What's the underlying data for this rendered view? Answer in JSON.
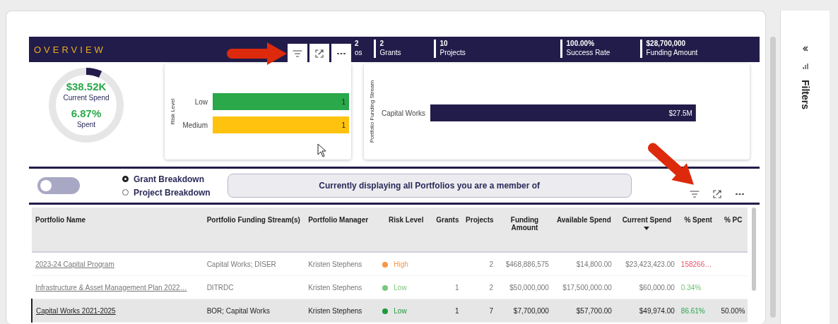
{
  "header": {
    "title": "OVERVIEW",
    "kpis": [
      {
        "value": "2",
        "label": "os"
      },
      {
        "value": "2",
        "label": "Grants"
      },
      {
        "value": "10",
        "label": "Projects"
      },
      {
        "value": "100.00%",
        "label": "Success Rate"
      },
      {
        "value": "$28,700,000",
        "label": "Funding Amount"
      }
    ]
  },
  "gauge": {
    "level": 0.0687,
    "amount": "$38.52K",
    "amount_label": "Current Spend",
    "percent": "6.87%",
    "percent_label": "Spent"
  },
  "risk_chart": {
    "chart_data": {
      "type": "bar",
      "orientation": "horizontal",
      "ylabel": "Risk Level",
      "categories": [
        "Low",
        "Medium"
      ],
      "values": [
        1,
        1
      ],
      "colors": [
        "#2aa84a",
        "#ffc20e"
      ],
      "data_labels": true
    }
  },
  "funding_chart": {
    "chart_data": {
      "type": "bar",
      "orientation": "horizontal",
      "ylabel": "Portfolio Funding Stream",
      "categories": [
        "Capital Works"
      ],
      "values": [
        27.5
      ],
      "colors": [
        "#221c4a"
      ],
      "value_labels": [
        "$27.5M"
      ]
    }
  },
  "toggle": {
    "on": false
  },
  "breakdown": [
    {
      "label": "Grant Breakdown",
      "selected": true
    },
    {
      "label": "Project Breakdown",
      "selected": false
    }
  ],
  "banner": "Currently displaying all Portfolios you are a member of",
  "table": {
    "columns": [
      {
        "label": "Portfolio Name",
        "sorted": false
      },
      {
        "label": "Portfolio Funding Stream(s)",
        "sorted": false
      },
      {
        "label": "Portfolio Manager",
        "sorted": false
      },
      {
        "label": "Risk Level",
        "sorted": false
      },
      {
        "label": "Grants",
        "sorted": false
      },
      {
        "label": "Projects",
        "sorted": false
      },
      {
        "label": "Funding Amount",
        "sorted": false
      },
      {
        "label": "Available Spend",
        "sorted": false
      },
      {
        "label": "Current Spend",
        "sorted": true
      },
      {
        "label": "% Spent",
        "sorted": false
      },
      {
        "label": "% PC",
        "sorted": false
      }
    ],
    "rows": [
      {
        "selected": false,
        "name": "2023-24 Capital Program ",
        "stream": "Capital Works; DISER",
        "manager": "Kristen Stephens",
        "risk": {
          "text": "High",
          "color": "#f79646"
        },
        "grants": "",
        "projects": "2",
        "funding": "$468,886,575",
        "available": "$14,800.00",
        "current": "$23,423,423.00",
        "spent": {
          "text": "158266…",
          "color": "#e8506a"
        },
        "pc": ""
      },
      {
        "selected": false,
        "name": "Infrastructure & Asset Management Plan 2022…",
        "stream": "DITRDC",
        "manager": "Kristen Stephens",
        "risk": {
          "text": "Low",
          "color": "#7bc67e"
        },
        "grants": "1",
        "projects": "2",
        "funding": "$50,000,000",
        "available": "$17,500,000.00",
        "current": "$60,000.00",
        "spent": {
          "text": "0.34%",
          "color": "#6cc070"
        },
        "pc": ""
      },
      {
        "selected": true,
        "name": "Capital Works 2021-2025",
        "stream": "BOR; Capital Works",
        "manager": "Kristen Stephens",
        "risk": {
          "text": "Low",
          "color": "#1f9a3a"
        },
        "grants": "1",
        "projects": "7",
        "funding": "$7,700,000",
        "available": "$57,700.00",
        "current": "$49,974.00",
        "spent": {
          "text": "86.61%",
          "color": "#2aa84a"
        },
        "pc": "50.00%"
      }
    ]
  },
  "filters_pane": {
    "title": "Filters"
  }
}
